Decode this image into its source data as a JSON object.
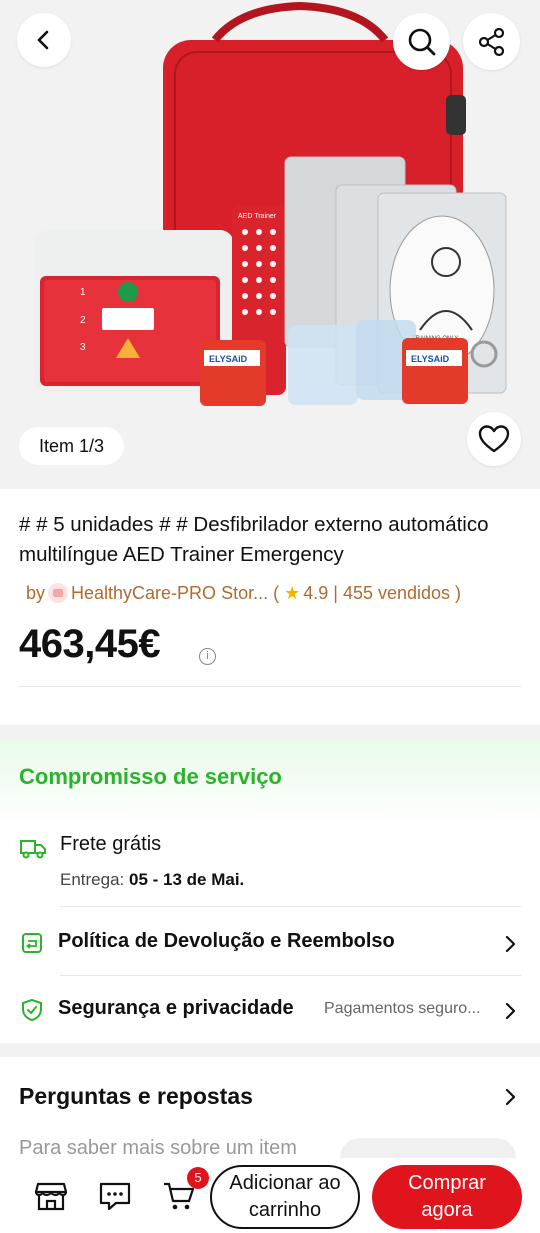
{
  "hero": {
    "item_counter": "Item 1/3",
    "image_subject": "AED trainer kit with red bag, electrode pads and keychain face shields",
    "printed_text": {
      "device_label": "AED Trainer",
      "keychain_brand": "ELYSAiD",
      "pad_label": "TRAINING ONLY"
    },
    "icons": {
      "back": "chevron-left-icon",
      "search": "search-icon",
      "share": "share-icon",
      "favorite": "heart-icon"
    }
  },
  "product": {
    "title": "# # 5 unidades # #   Desfibrilador externo automático multilíngue AED Trainer Emergency",
    "seller_prefix": "by",
    "seller_name": "HealthyCare-PRO Stor...",
    "rating": "4.9",
    "sold": "455 vendidos",
    "price": "463,45€"
  },
  "service": {
    "title": "Compromisso de serviço",
    "shipping_title": "Frete grátis",
    "delivery_label": "Entrega:",
    "delivery_dates": "05 - 13 de Mai.",
    "returns_title": "Política de Devolução e Reembolso",
    "security_title": "Segurança e privacidade",
    "security_extra": "Pagamentos seguro..."
  },
  "qa": {
    "title": "Perguntas e repostas",
    "subtitle": "Para saber mais sobre um item"
  },
  "bottom_bar": {
    "cart_count": "5",
    "add_to_cart_line1": "Adicionar ao",
    "add_to_cart_line2": "carrinho",
    "buy_now_line1": "Comprar",
    "buy_now_line2": "agora"
  },
  "colors": {
    "accent_red": "#e0141d",
    "service_green": "#2bb32b",
    "seller_brown": "#b26a2d",
    "star_gold": "#f0b400"
  }
}
